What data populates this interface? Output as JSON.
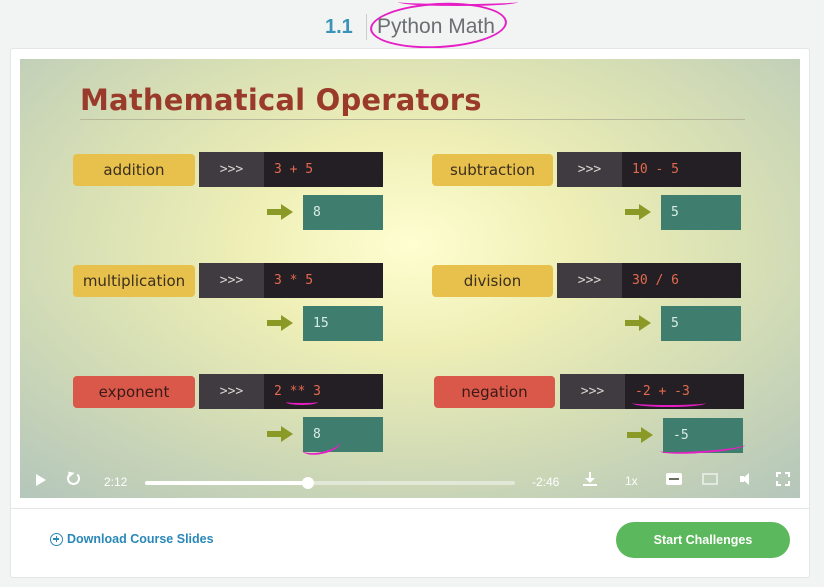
{
  "header": {
    "lesson_number": "1.1",
    "lesson_title": "Python Math"
  },
  "slide": {
    "title": "Mathematical Operators",
    "prompt": ">>>",
    "operators": [
      {
        "label": "addition",
        "code": "3 + 5",
        "result": "8",
        "color": "#e8c04c"
      },
      {
        "label": "subtraction",
        "code": "10 - 5",
        "result": "5",
        "color": "#e8c04c"
      },
      {
        "label": "multiplication",
        "code": "3 * 5",
        "result": "15",
        "color": "#e8c04c"
      },
      {
        "label": "division",
        "code": "30 / 6",
        "result": "5",
        "color": "#e8c04c"
      },
      {
        "label": "exponent",
        "code": "2 ** 3",
        "result": "8",
        "color": "#d9584a"
      },
      {
        "label": "negation",
        "code": "-2 + -3",
        "result": "-5",
        "color": "#d9584a"
      }
    ]
  },
  "player": {
    "elapsed": "2:12",
    "remaining": "-2:46",
    "speed": "1x",
    "progress_fraction": 0.44
  },
  "footer": {
    "download_label": "Download Course Slides",
    "start_label": "Start Challenges"
  },
  "colors": {
    "accent_blue": "#2a88b8",
    "start_green": "#5cb85c",
    "annotation_pink": "#e51ec5"
  }
}
